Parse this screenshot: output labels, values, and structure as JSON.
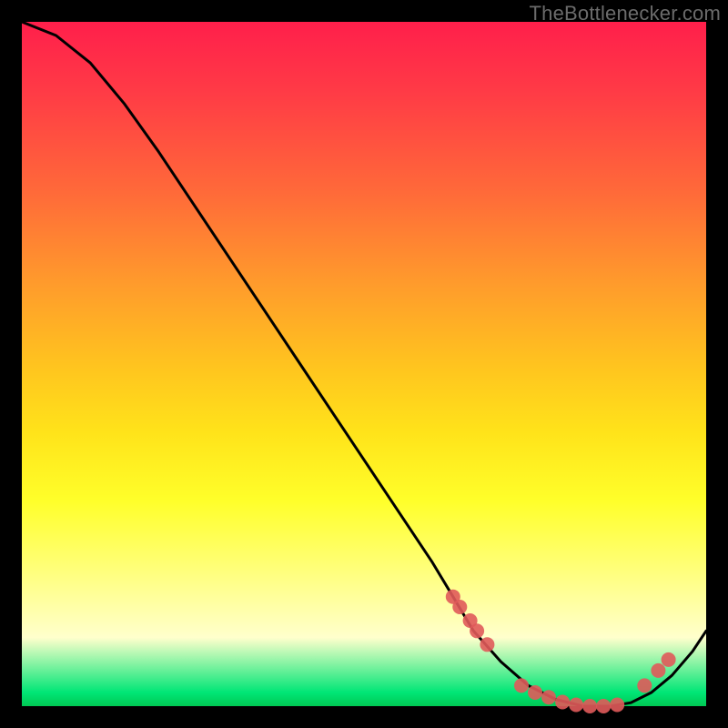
{
  "watermark": "TheBottlenecker.com",
  "chart_data": {
    "type": "line",
    "title": "",
    "xlabel": "",
    "ylabel": "",
    "xlim": [
      0,
      100
    ],
    "ylim": [
      0,
      100
    ],
    "x": [
      0,
      5,
      10,
      15,
      20,
      25,
      30,
      35,
      40,
      45,
      50,
      55,
      60,
      63,
      66,
      70,
      74,
      78,
      82,
      86,
      89,
      92,
      95,
      98,
      100
    ],
    "values": [
      100,
      98,
      94,
      88,
      81,
      73.5,
      66,
      58.5,
      51,
      43.5,
      36,
      28.5,
      21,
      16,
      11,
      6.5,
      3,
      1,
      0,
      0,
      0.5,
      2,
      4.5,
      8,
      11
    ],
    "marker_clusters": [
      {
        "xs": [
          63,
          64,
          65.5,
          66.5,
          68
        ],
        "ys": [
          16,
          14.5,
          12.5,
          11,
          9
        ]
      },
      {
        "xs": [
          73,
          75,
          77,
          79,
          81,
          83,
          85,
          87
        ],
        "ys": [
          3,
          2,
          1.3,
          0.6,
          0.2,
          0,
          0,
          0.2
        ]
      },
      {
        "xs": [
          91,
          93,
          94.5
        ],
        "ys": [
          3,
          5.2,
          6.8
        ]
      }
    ],
    "background_gradient": {
      "top": "#ff1f4b",
      "mid": "#ffe31a",
      "bottom": "#00c853"
    },
    "line_color": "#000000",
    "marker_color": "#e05a5a"
  }
}
